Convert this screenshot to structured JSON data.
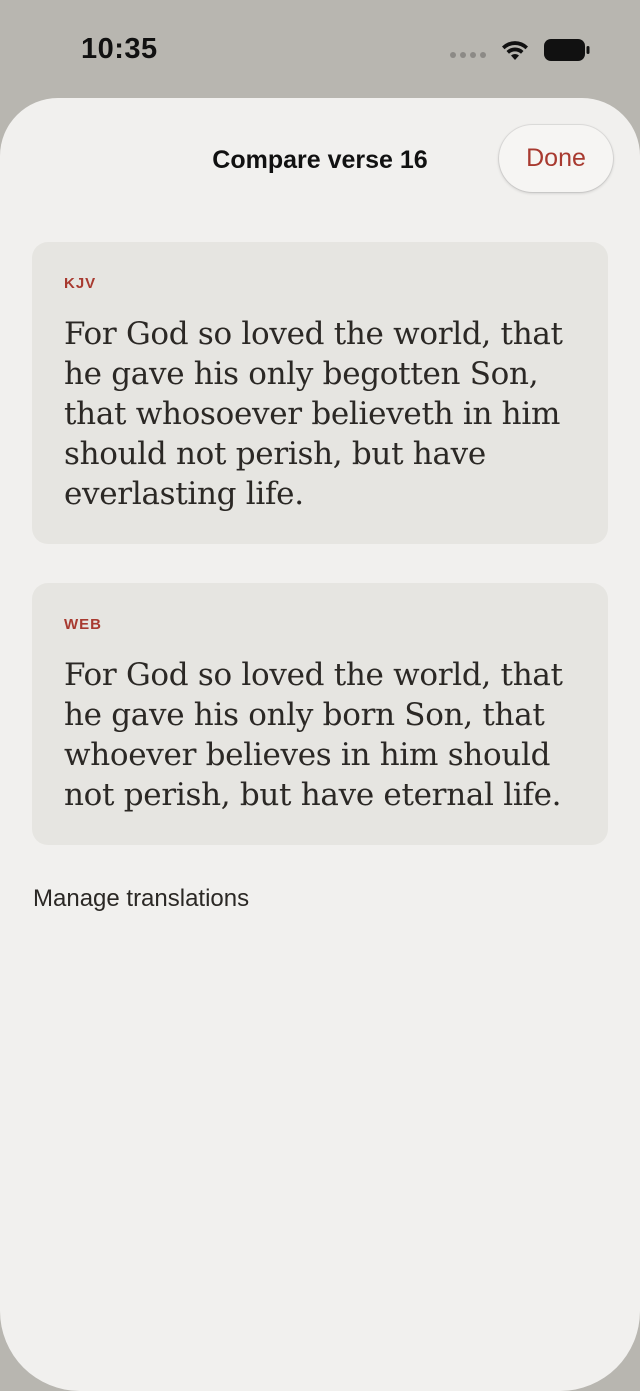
{
  "status_bar": {
    "time": "10:35",
    "icons": [
      "signal-dots-icon",
      "wifi-icon",
      "battery-icon"
    ]
  },
  "sheet": {
    "title": "Compare verse 16",
    "done_label": "Done"
  },
  "translations": [
    {
      "tag": "KJV",
      "text": "For God so loved the world, that he gave his only begotten Son, that whosoever believeth in him should not perish, but have everlasting life."
    },
    {
      "tag": "WEB",
      "text": "For God so loved the world, that he gave his only born Son, that whoever believes in him should not perish, but have eternal life."
    }
  ],
  "manage_label": "Manage translations",
  "colors": {
    "accent": "#a83a30",
    "sheet_background": "#f1f0ee",
    "card_background": "#e6e5e1",
    "backdrop": "#b8b6b0"
  }
}
